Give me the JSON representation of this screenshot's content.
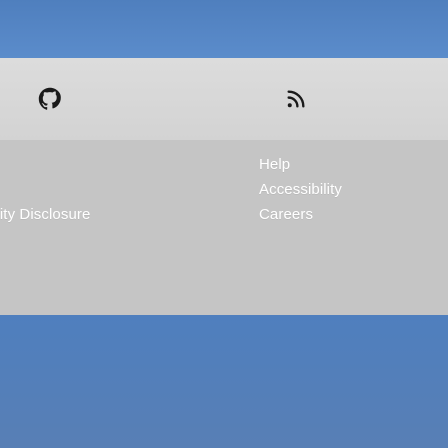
{
  "header": {
    "band_color": "#5686c5"
  },
  "icons": {
    "github": "github-icon",
    "rss": "rss-icon"
  },
  "footer": {
    "links": {
      "help": "Help",
      "accessibility": "Accessibility",
      "careers": "Careers",
      "disclosure": "ility Disclosure"
    }
  },
  "colors": {
    "blue": "#5686c5",
    "gray": "#c5c5c5",
    "light_gray": "#d8d8d8",
    "text": "#ffffff"
  }
}
